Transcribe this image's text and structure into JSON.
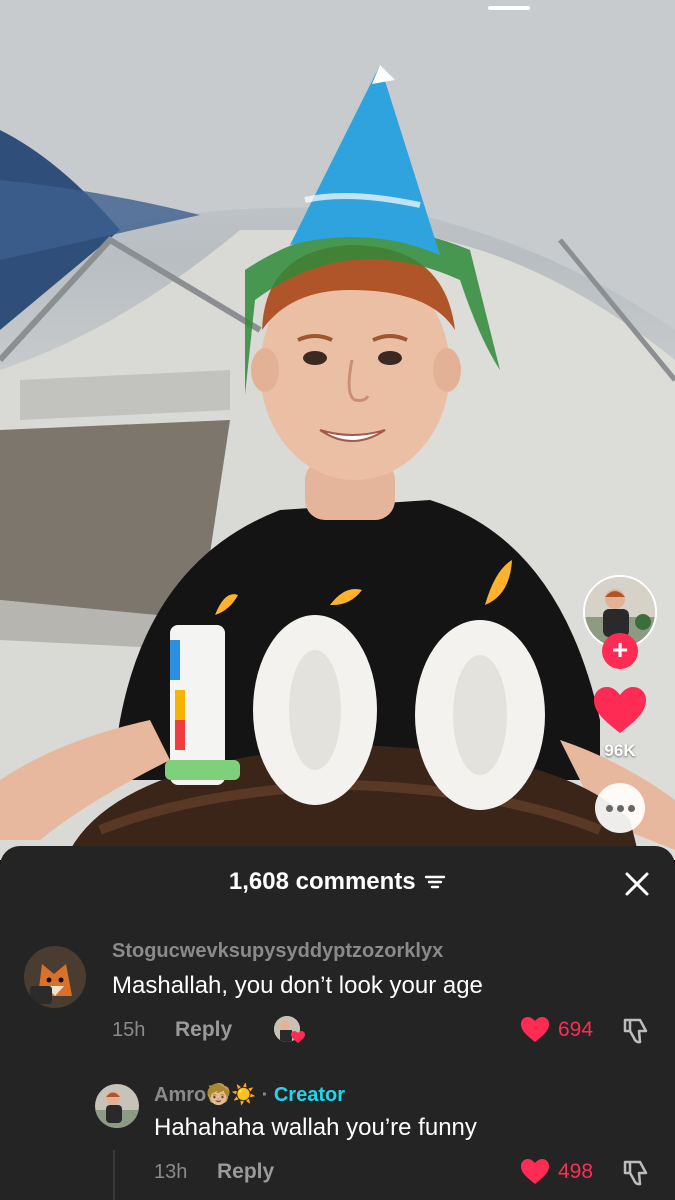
{
  "video": {
    "like_count": "96K"
  },
  "comments_panel": {
    "count_label": "1,608 comments",
    "comments": [
      {
        "username": "Stogucwevksupysyddyptzozorklyx",
        "text": "Mashallah, you don’t look your age",
        "time": "15h",
        "reply_label": "Reply",
        "like_count": "694"
      },
      {
        "username": "Amro",
        "username_emoji": "🧒🏼☀️",
        "separator": "·",
        "creator_tag": "Creator",
        "text": "Hahahaha wallah you’re funny",
        "time": "13h",
        "reply_label": "Reply",
        "like_count": "498"
      }
    ]
  },
  "colors": {
    "accent": "#fe2c55",
    "creator_tag": "#20d5ec",
    "sheet_bg": "#242424"
  },
  "icons": [
    "plus-icon",
    "heart-icon",
    "more-icon",
    "filter-icon",
    "close-icon",
    "dislike-icon"
  ]
}
